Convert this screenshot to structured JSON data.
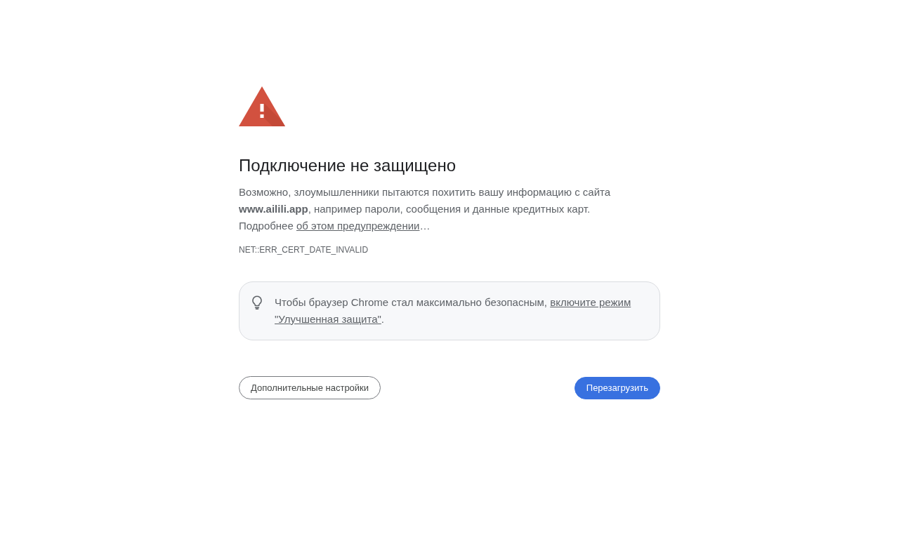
{
  "heading": "Подключение не защищено",
  "description": {
    "text": "Возможно, злоумышленники пытаются похитить вашу информацию с сайта **www.ailili.app**, например пароли, сообщения и данные кредитных карт.",
    "learn_more_prefix": "Подробнее",
    "learn_more_link": "об этом предупреждении",
    "learn_more_suffix": "…"
  },
  "error_code": "NET::ERR_CERT_DATE_INVALID",
  "callout": {
    "text": "Чтобы браузер Chrome стал максимально безопасным,",
    "link_lines": [
      "включите режим",
      "\"Улучшенная защита\""
    ],
    "suffix": "."
  },
  "buttons": [
    {
      "kind": "secondary",
      "label": "Дополнительные настройки"
    },
    {
      "kind": "primary",
      "label": "Перезагрузить"
    }
  ]
}
